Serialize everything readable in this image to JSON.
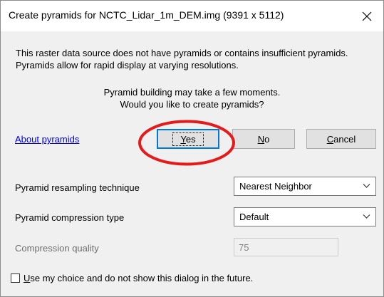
{
  "window": {
    "title": "Create pyramids for NCTC_Lidar_1m_DEM.img (9391 x 5112)",
    "close_glyph": "✕"
  },
  "message": {
    "line1": "This raster data source does not have pyramids or contains insufficient pyramids.",
    "line2": "Pyramids allow for rapid display at varying resolutions.",
    "center_line1": "Pyramid building may take a few moments.",
    "center_line2": "Would you like to create pyramids?"
  },
  "about_link": "About pyramids",
  "buttons": {
    "yes": {
      "mnemonic": "Y",
      "rest": "es"
    },
    "no": {
      "mnemonic": "N",
      "rest": "o"
    },
    "cancel": {
      "mnemonic": "C",
      "rest": "ancel"
    }
  },
  "settings": {
    "resampling_label": "Pyramid resampling technique",
    "resampling_value": "Nearest Neighbor",
    "compression_label": "Pyramid compression type",
    "compression_value": "Default",
    "quality_label": "Compression quality",
    "quality_value": "75"
  },
  "remember": {
    "mnemonic": "U",
    "rest": "se my choice and do not show this dialog in the future."
  },
  "colors": {
    "annotation_circle": "#e31b1b",
    "link": "#0000ee",
    "default_button_border": "#0078d7"
  }
}
